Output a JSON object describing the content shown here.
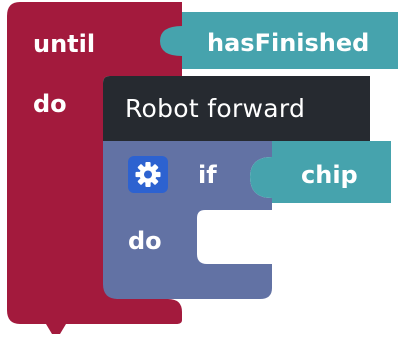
{
  "colors": {
    "loop_block": "#a31a3d",
    "value_block": "#46a3ad",
    "robot_block": "#262a30",
    "logic_block": "#6272a4",
    "mutator_gear": "#2d62d0"
  },
  "until_block": {
    "keyword_until": "until",
    "keyword_do": "do",
    "condition": "hasFinished"
  },
  "robot_block": {
    "label": "Robot forward"
  },
  "if_block": {
    "gear_icon": "gear-icon",
    "keyword_if": "if",
    "keyword_do": "do",
    "condition": "chip"
  }
}
